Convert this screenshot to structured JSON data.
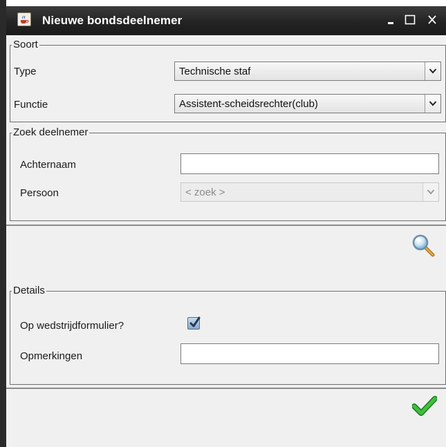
{
  "window": {
    "title": "Nieuwe bondsdeelnemer",
    "controls": {
      "minimize": "minimize",
      "maximize": "maximize",
      "close": "close"
    }
  },
  "soort": {
    "legend": "Soort",
    "type_label": "Type",
    "type_value": "Technische staf",
    "functie_label": "Functie",
    "functie_value": "Assistent-scheidsrechter(club)"
  },
  "zoek": {
    "legend": "Zoek deelnemer",
    "achternaam_label": "Achternaam",
    "achternaam_value": "",
    "persoon_label": "Persoon",
    "persoon_value": "< zoek >"
  },
  "details": {
    "legend": "Details",
    "wedstrijd_label": "Op wedstrijdformulier?",
    "wedstrijd_checked": true,
    "opmerkingen_label": "Opmerkingen",
    "opmerkingen_value": ""
  },
  "icons": {
    "app": "java-cup-icon",
    "search": "magnifier-icon",
    "confirm": "green-check-icon"
  },
  "colors": {
    "titlebar": "#262626",
    "confirm_green": "#2ea12e"
  }
}
